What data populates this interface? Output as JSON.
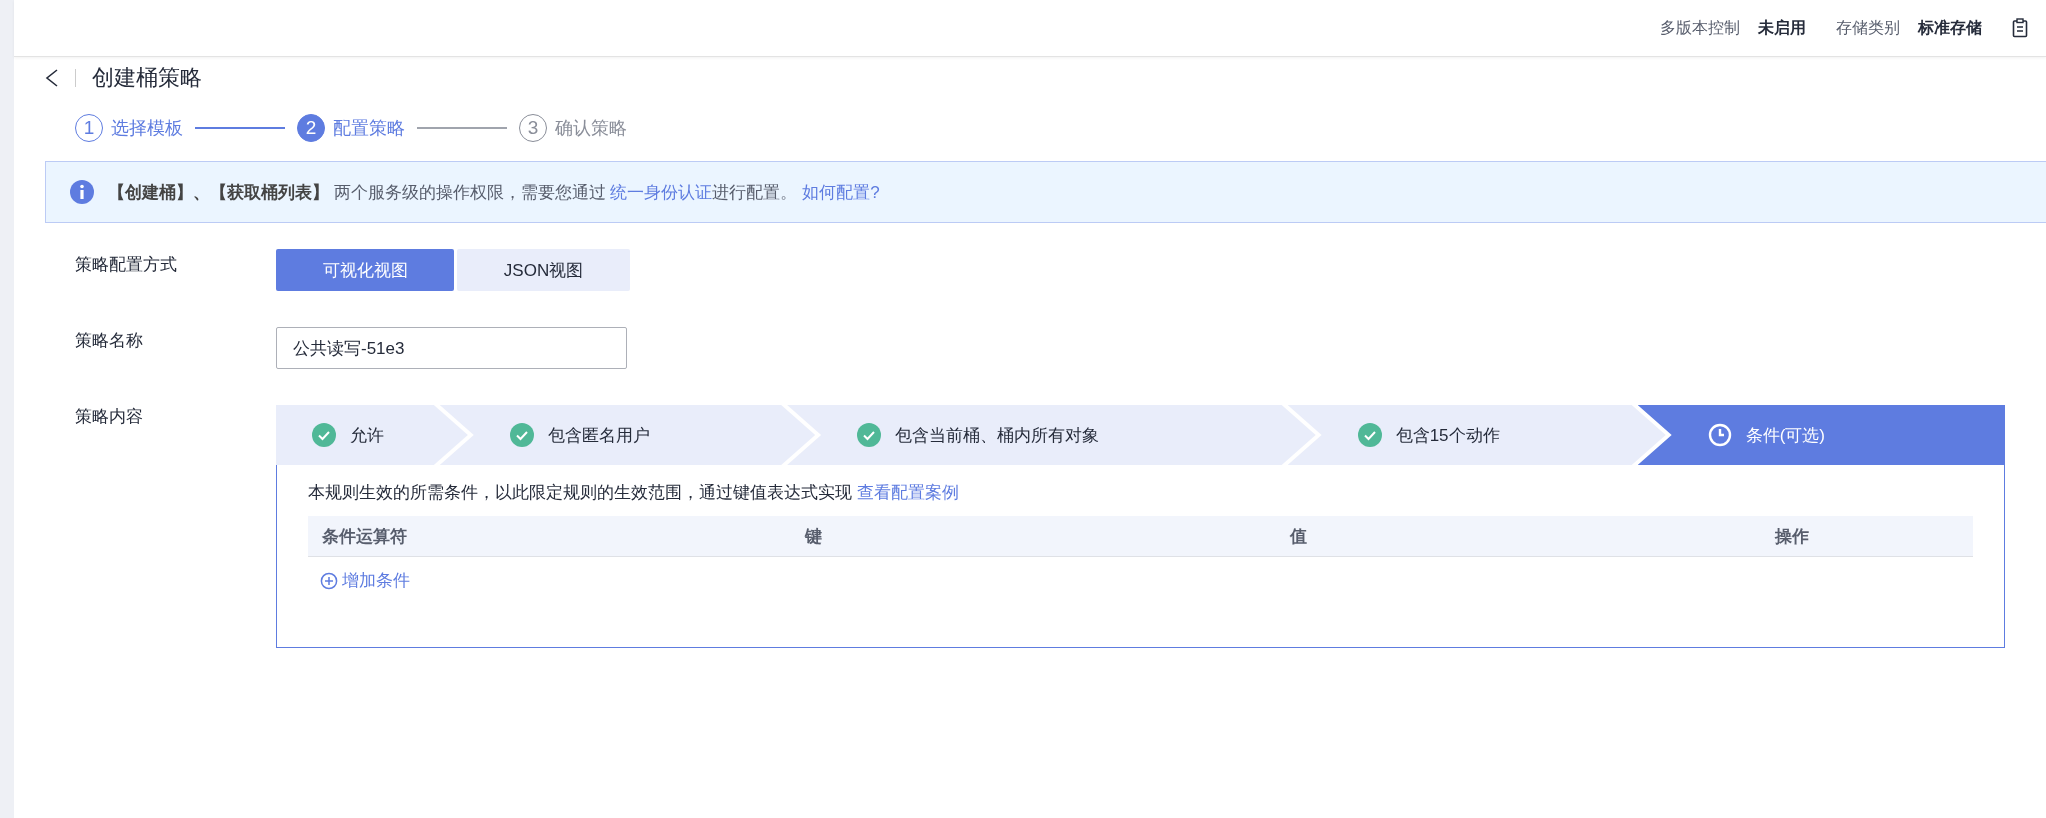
{
  "header": {
    "items": [
      {
        "label": "多版本控制",
        "value": "未启用"
      },
      {
        "label": "存储类别",
        "value": "标准存储"
      }
    ]
  },
  "page_title": "创建桶策略",
  "wizard_steps": [
    {
      "number": "1",
      "label": "选择模板",
      "completed": true,
      "selected": false
    },
    {
      "number": "2",
      "label": "配置策略",
      "completed": false,
      "selected": true
    },
    {
      "number": "3",
      "label": "确认策略",
      "completed": false,
      "selected": false
    }
  ],
  "notice": {
    "text": "**【创建桶】、【获取桶列表】** 两个服务级的操作权限，需要您通过 ",
    "link": "统一身份认证",
    "text_after": "进行配置。",
    "help_link": "如何配置?"
  },
  "form": {
    "mode": {
      "label": "策略配置方式",
      "options": [
        {
          "label": "可视化视图",
          "selected": true
        },
        {
          "label": "JSON视图",
          "selected": false
        }
      ]
    },
    "name": {
      "label": "策略名称",
      "value": "公共读写-51e3"
    },
    "content": {
      "label": "策略内容",
      "steps": [
        {
          "label": "允许",
          "completed": true,
          "selected": false
        },
        {
          "label": "包含匿名用户",
          "completed": true,
          "selected": false
        },
        {
          "label": "包含当前桶、桶内所有对象",
          "completed": true,
          "selected": false
        },
        {
          "label": "包含15个动作",
          "completed": true,
          "selected": false
        },
        {
          "label": "条件(可选)",
          "completed": false,
          "selected": true
        }
      ],
      "description": "本规则生效的所需条件，以此限定规则的生效范围，通过键值表达式实现 ",
      "description_link": "查看配置案例",
      "table": {
        "columns": [
          "条件运算符",
          "键",
          "值",
          "操作"
        ]
      },
      "add_button": "增加条件"
    }
  }
}
